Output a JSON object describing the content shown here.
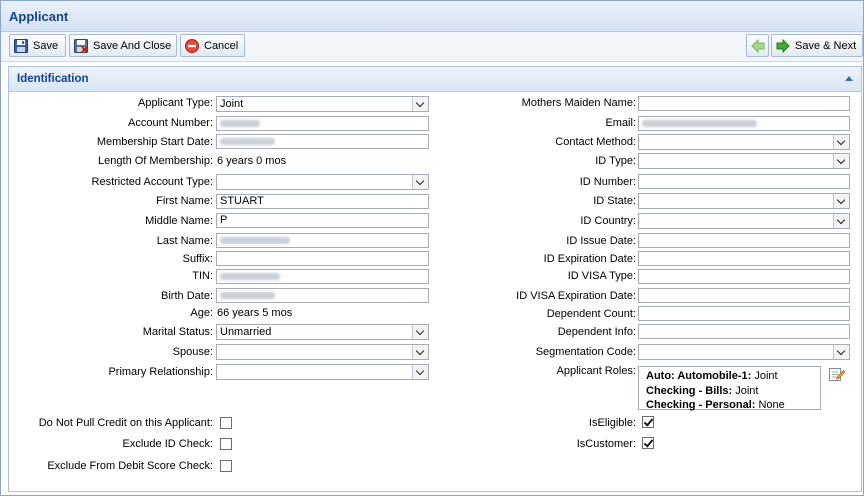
{
  "window": {
    "title": "Applicant"
  },
  "toolbar": {
    "save": "Save",
    "save_close": "Save And Close",
    "cancel": "Cancel",
    "save_next": "Save & Next"
  },
  "panel": {
    "title": "Identification"
  },
  "left": {
    "applicant_type": {
      "label": "Applicant Type:",
      "value": "Joint"
    },
    "account_number": {
      "label": "Account Number:"
    },
    "membership_start_date": {
      "label": "Membership Start Date:"
    },
    "length_of_membership": {
      "label": "Length Of Membership:",
      "value": "6 years 0 mos"
    },
    "restricted_account_type": {
      "label": "Restricted Account Type:",
      "value": ""
    },
    "first_name": {
      "label": "First Name:",
      "value": "STUART"
    },
    "middle_name": {
      "label": "Middle Name:",
      "value": "P"
    },
    "last_name": {
      "label": "Last Name:"
    },
    "suffix": {
      "label": "Suffix:",
      "value": ""
    },
    "tin": {
      "label": "TIN:"
    },
    "birth_date": {
      "label": "Birth Date:"
    },
    "age": {
      "label": "Age:",
      "value": "66 years 5 mos"
    },
    "marital_status": {
      "label": "Marital Status:",
      "value": "Unmarried"
    },
    "spouse": {
      "label": "Spouse:",
      "value": ""
    },
    "primary_relationship": {
      "label": "Primary Relationship:",
      "value": ""
    }
  },
  "right": {
    "mothers_maiden_name": {
      "label": "Mothers Maiden Name:",
      "value": ""
    },
    "email": {
      "label": "Email:"
    },
    "contact_method": {
      "label": "Contact Method:",
      "value": ""
    },
    "id_type": {
      "label": "ID Type:",
      "value": ""
    },
    "id_number": {
      "label": "ID Number:",
      "value": ""
    },
    "id_state": {
      "label": "ID State:",
      "value": ""
    },
    "id_country": {
      "label": "ID Country:",
      "value": ""
    },
    "id_issue_date": {
      "label": "ID Issue Date:",
      "value": ""
    },
    "id_expiration_date": {
      "label": "ID Expiration Date:",
      "value": ""
    },
    "id_visa_type": {
      "label": "ID VISA Type:",
      "value": ""
    },
    "id_visa_expiration_date": {
      "label": "ID VISA Expiration Date:",
      "value": ""
    },
    "dependent_count": {
      "label": "Dependent Count:",
      "value": ""
    },
    "dependent_info": {
      "label": "Dependent Info:",
      "value": ""
    },
    "segmentation_code": {
      "label": "Segmentation Code:",
      "value": ""
    },
    "applicant_roles": {
      "label": "Applicant Roles:",
      "items": [
        {
          "name": "Auto: Automobile-1:",
          "value": "Joint"
        },
        {
          "name": "Checking - Bills:",
          "value": "Joint"
        },
        {
          "name": "Checking - Personal:",
          "value": "None"
        }
      ]
    }
  },
  "checks": {
    "do_not_pull_credit": {
      "label": "Do Not Pull Credit on this Applicant:",
      "checked": false
    },
    "exclude_id_check": {
      "label": "Exclude ID Check:",
      "checked": false
    },
    "exclude_debit_score": {
      "label": "Exclude From Debit Score Check:",
      "checked": false
    },
    "is_eligible": {
      "label": "IsEligible:",
      "checked": true
    },
    "is_customer": {
      "label": "IsCustomer:",
      "checked": true
    }
  },
  "icons": {
    "save": "floppy-disk-icon",
    "save_close": "floppy-disk-close-icon",
    "cancel": "cancel-icon",
    "back": "green-arrow-left-icon",
    "next": "green-arrow-right-icon",
    "edit": "edit-pencil-icon"
  }
}
